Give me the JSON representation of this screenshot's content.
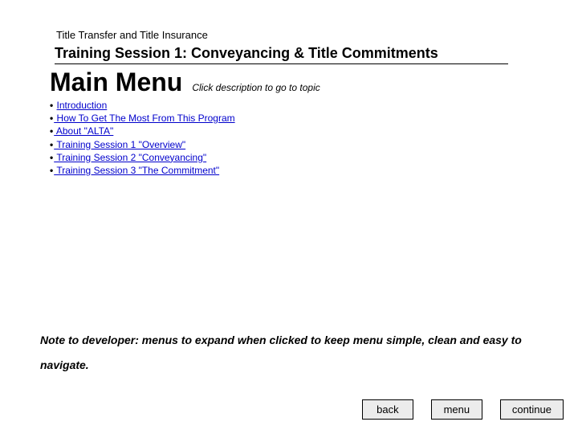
{
  "header": {
    "small": "Title Transfer and Title Insurance",
    "title": "Training Session 1: Conveyancing & Title Commitments"
  },
  "main_menu": {
    "title": "Main Menu",
    "hint": "Click description to go to topic"
  },
  "menu_items": [
    {
      "label": "Introduction"
    },
    {
      "label": " How To Get The Most From This Program"
    },
    {
      "label": " About \"ALTA\""
    },
    {
      "label": " Training Session 1 \"Overview\""
    },
    {
      "label": " Training Session 2 \"Conveyancing\""
    },
    {
      "label": " Training Session 3 \"The Commitment\""
    }
  ],
  "dev_note": "Note to developer: menus to expand when clicked to keep menu simple, clean and easy to navigate.",
  "buttons": {
    "back": "back",
    "menu": "menu",
    "continue": "continue"
  }
}
